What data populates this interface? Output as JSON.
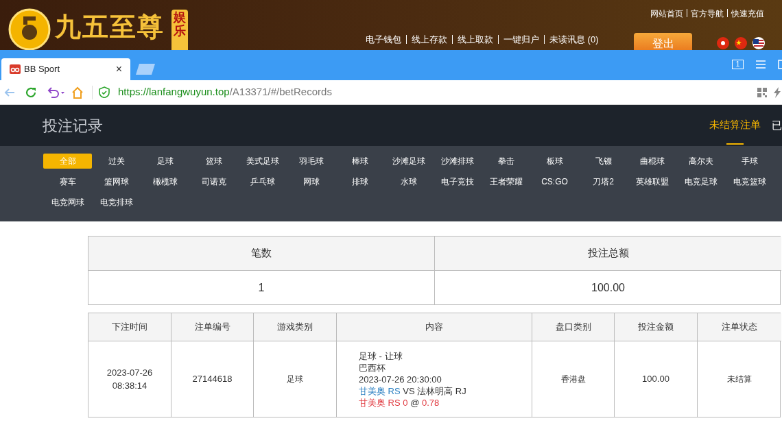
{
  "site_header": {
    "logo_text": "九五至尊",
    "logo_badge": "娱乐",
    "top_links": [
      "网站首页",
      "官方导航",
      "快速充值"
    ],
    "nav_links": [
      "电子钱包",
      "线上存款",
      "线上取款",
      "一键归户",
      "未读讯息 (0)"
    ],
    "logout_button": "登出"
  },
  "browser": {
    "tab": {
      "title": "BB Sport",
      "close": "×"
    },
    "tab_counter": "1",
    "url": {
      "scheme": "https://",
      "host": "lanfangwuyun.top",
      "path": "/A13371/#/betRecords"
    }
  },
  "page": {
    "title": "投注记录",
    "tabs": [
      {
        "label": "未结算注单",
        "selected": true
      },
      {
        "label": "已",
        "selected": false
      }
    ]
  },
  "sports": [
    {
      "label": "全部",
      "selected": true
    },
    {
      "label": "过关",
      "selected": false
    },
    {
      "label": "足球",
      "selected": false
    },
    {
      "label": "篮球",
      "selected": false
    },
    {
      "label": "美式足球",
      "selected": false
    },
    {
      "label": "羽毛球",
      "selected": false
    },
    {
      "label": "棒球",
      "selected": false
    },
    {
      "label": "沙滩足球",
      "selected": false
    },
    {
      "label": "沙滩排球",
      "selected": false
    },
    {
      "label": "拳击",
      "selected": false
    },
    {
      "label": "板球",
      "selected": false
    },
    {
      "label": "飞镖",
      "selected": false
    },
    {
      "label": "曲棍球",
      "selected": false
    },
    {
      "label": "高尔夫",
      "selected": false
    },
    {
      "label": "手球",
      "selected": false
    },
    {
      "label": "赛车",
      "selected": false
    },
    {
      "label": "篮网球",
      "selected": false
    },
    {
      "label": "橄榄球",
      "selected": false
    },
    {
      "label": "司诺克",
      "selected": false
    },
    {
      "label": "乒乓球",
      "selected": false
    },
    {
      "label": "网球",
      "selected": false
    },
    {
      "label": "排球",
      "selected": false
    },
    {
      "label": "水球",
      "selected": false
    },
    {
      "label": "电子竞技",
      "selected": false
    },
    {
      "label": "王者荣耀",
      "selected": false
    },
    {
      "label": "CS:GO",
      "selected": false
    },
    {
      "label": "刀塔2",
      "selected": false
    },
    {
      "label": "英雄联盟",
      "selected": false
    },
    {
      "label": "电竞足球",
      "selected": false
    },
    {
      "label": "电竞篮球",
      "selected": false
    },
    {
      "label": "电竞网球",
      "selected": false
    },
    {
      "label": "电竞排球",
      "selected": false
    }
  ],
  "summary": {
    "columns": [
      "笔数",
      "投注总额"
    ],
    "values": [
      "1",
      "100.00"
    ]
  },
  "bets": {
    "columns": [
      "下注时间",
      "注单编号",
      "游戏类别",
      "内容",
      "盘口类别",
      "投注金额",
      "注单状态"
    ],
    "rows": [
      {
        "time": [
          "2023-07-26",
          "08:38:14"
        ],
        "number": "27144618",
        "game": "足球",
        "content": [
          [
            {
              "text": "足球 - 让球",
              "color": "#333333"
            }
          ],
          [
            {
              "text": "巴西杯",
              "color": "#333333"
            }
          ],
          [
            {
              "text": "2023-07-26 20:30:00",
              "color": "#333333"
            }
          ],
          [
            {
              "text": "甘美奥 RS",
              "color": "#2a7fc1"
            },
            {
              "text": " VS 法林明高 RJ",
              "color": "#333333"
            }
          ],
          [
            {
              "text": "甘美奥 RS 0",
              "color": "#e0383e"
            },
            {
              "text": " @ ",
              "color": "#333333"
            },
            {
              "text": "0.78",
              "color": "#e0383e"
            }
          ]
        ],
        "odds_type": "香港盘",
        "amount": "100.00",
        "status": "未结算"
      }
    ]
  }
}
